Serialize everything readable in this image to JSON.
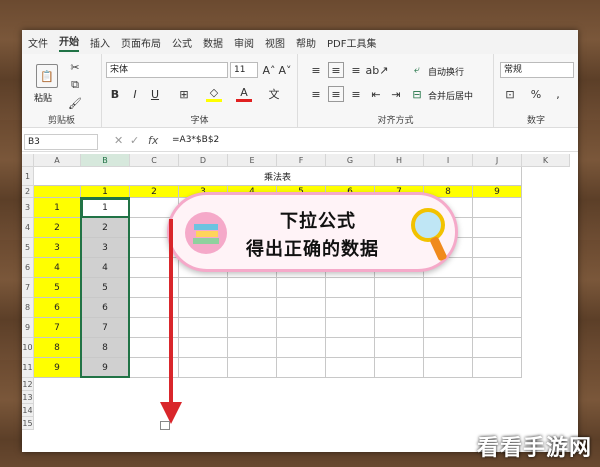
{
  "menu": [
    "文件",
    "开始",
    "插入",
    "页面布局",
    "公式",
    "数据",
    "审阅",
    "视图",
    "帮助",
    "PDF工具集"
  ],
  "ribbon": {
    "paste_label": "粘贴",
    "clipboard_label": "剪贴板",
    "font_name": "宋体",
    "font_size": "11",
    "font_label": "字体",
    "wrap_text": "自动换行",
    "merge_center": "合并后居中",
    "align_label": "对齐方式",
    "number_format": "常规",
    "number_label": "数字"
  },
  "formula_bar": {
    "name_box": "B3",
    "formula": "=A3*$B$2"
  },
  "columns": [
    "A",
    "B",
    "C",
    "D",
    "E",
    "F",
    "G",
    "H",
    "I",
    "J",
    "K"
  ],
  "rows": [
    "1",
    "2",
    "3",
    "4",
    "5",
    "6",
    "7",
    "8",
    "9",
    "10",
    "11",
    "12",
    "13",
    "14",
    "15"
  ],
  "sheet": {
    "title": "乘法表",
    "header_row": [
      "1",
      "2",
      "3",
      "4",
      "5",
      "6",
      "7",
      "8",
      "9"
    ],
    "col_a": [
      "1",
      "2",
      "3",
      "4",
      "5",
      "6",
      "7",
      "8",
      "9"
    ],
    "col_b": [
      "1",
      "2",
      "3",
      "4",
      "5",
      "6",
      "7",
      "8",
      "9"
    ]
  },
  "overlay": {
    "line1": "下拉公式",
    "line2": "得出正确的数据"
  },
  "watermark": "看看手游网",
  "colors": {
    "yellow": "#ffff00",
    "gray": "#d0d0d0",
    "accent": "#217346",
    "arrow": "#d9262b"
  }
}
